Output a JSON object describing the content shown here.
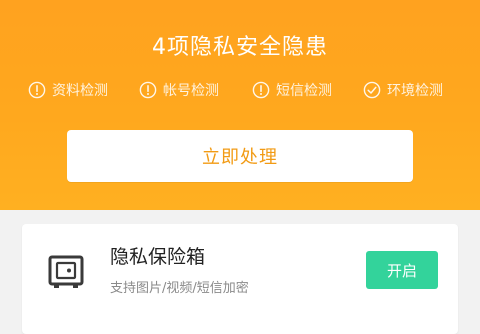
{
  "header": {
    "title": "4项隐私安全隐患",
    "checks": [
      {
        "icon": "exclamation-circle-icon",
        "label": "资料检测"
      },
      {
        "icon": "exclamation-circle-icon",
        "label": "帐号检测"
      },
      {
        "icon": "exclamation-circle-icon",
        "label": "短信检测"
      },
      {
        "icon": "check-circle-icon",
        "label": "环境检测"
      }
    ],
    "primary_button": "立即处理"
  },
  "card": {
    "icon": "vault-icon",
    "title": "隐私保险箱",
    "subtitle": "支持图片/视频/短信加密",
    "button": "开启"
  },
  "colors": {
    "header_bg": "#FFA81E",
    "primary_button_text": "#F29B14",
    "open_button_bg": "#33D39B"
  }
}
